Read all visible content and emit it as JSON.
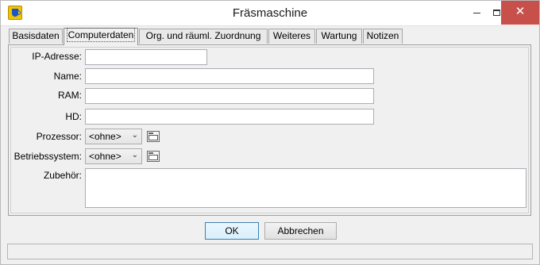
{
  "window": {
    "title": "Fräsmaschine",
    "close_glyph": "✕",
    "accent_close": "#c7504b",
    "app_icon": "mug-icon"
  },
  "tabs": [
    {
      "label": "Basisdaten",
      "active": false
    },
    {
      "label": "Computerdaten",
      "active": true
    },
    {
      "label": "Org. und räuml. Zuordnung",
      "active": false
    },
    {
      "label": "Weiteres",
      "active": false
    },
    {
      "label": "Wartung",
      "active": false
    },
    {
      "label": "Notizen",
      "active": false
    }
  ],
  "form": {
    "ip_label": "IP-Adresse:",
    "ip_value": "",
    "name_label": "Name:",
    "name_value": "",
    "ram_label": "RAM:",
    "ram_value": "",
    "hd_label": "HD:",
    "hd_value": "",
    "processor_label": "Prozessor:",
    "processor_value": "<ohne>",
    "os_label": "Betriebssystem:",
    "os_value": "<ohne>",
    "accessories_label": "Zubehör:",
    "accessories_value": ""
  },
  "buttons": {
    "ok": "OK",
    "cancel": "Abbrechen"
  },
  "status": {
    "text": ""
  }
}
